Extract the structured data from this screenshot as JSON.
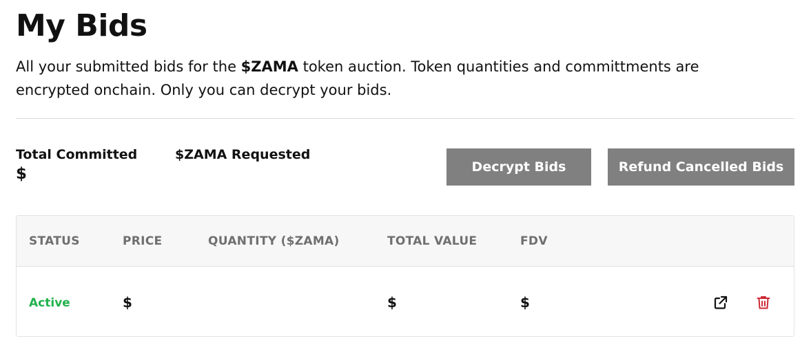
{
  "header": {
    "title": "My Bids",
    "subtitle_before": "All your submitted bids for the ",
    "subtitle_token": "$ZAMA",
    "subtitle_after": " token auction. Token quantities and committments are encrypted onchain. Only you can decrypt your bids."
  },
  "stats": {
    "total_committed": {
      "label": "Total Committed",
      "value": "$"
    },
    "requested": {
      "label": "$ZAMA Requested",
      "value": ""
    }
  },
  "actions": {
    "decrypt_label": "Decrypt Bids",
    "refund_label": "Refund Cancelled Bids"
  },
  "table": {
    "headers": [
      "STATUS",
      "PRICE",
      "QUANTITY ($ZAMA)",
      "TOTAL VALUE",
      "FDV"
    ],
    "rows": [
      {
        "status": "Active",
        "price": "$",
        "quantity": "",
        "total_value": "$",
        "fdv": "$"
      }
    ]
  },
  "icons": {
    "open": "external-link-icon",
    "delete": "trash-icon"
  },
  "colors": {
    "button_bg": "#808080",
    "status_active": "#22b14c",
    "delete_icon": "#cc2a36",
    "header_text": "#6f6f6f"
  }
}
